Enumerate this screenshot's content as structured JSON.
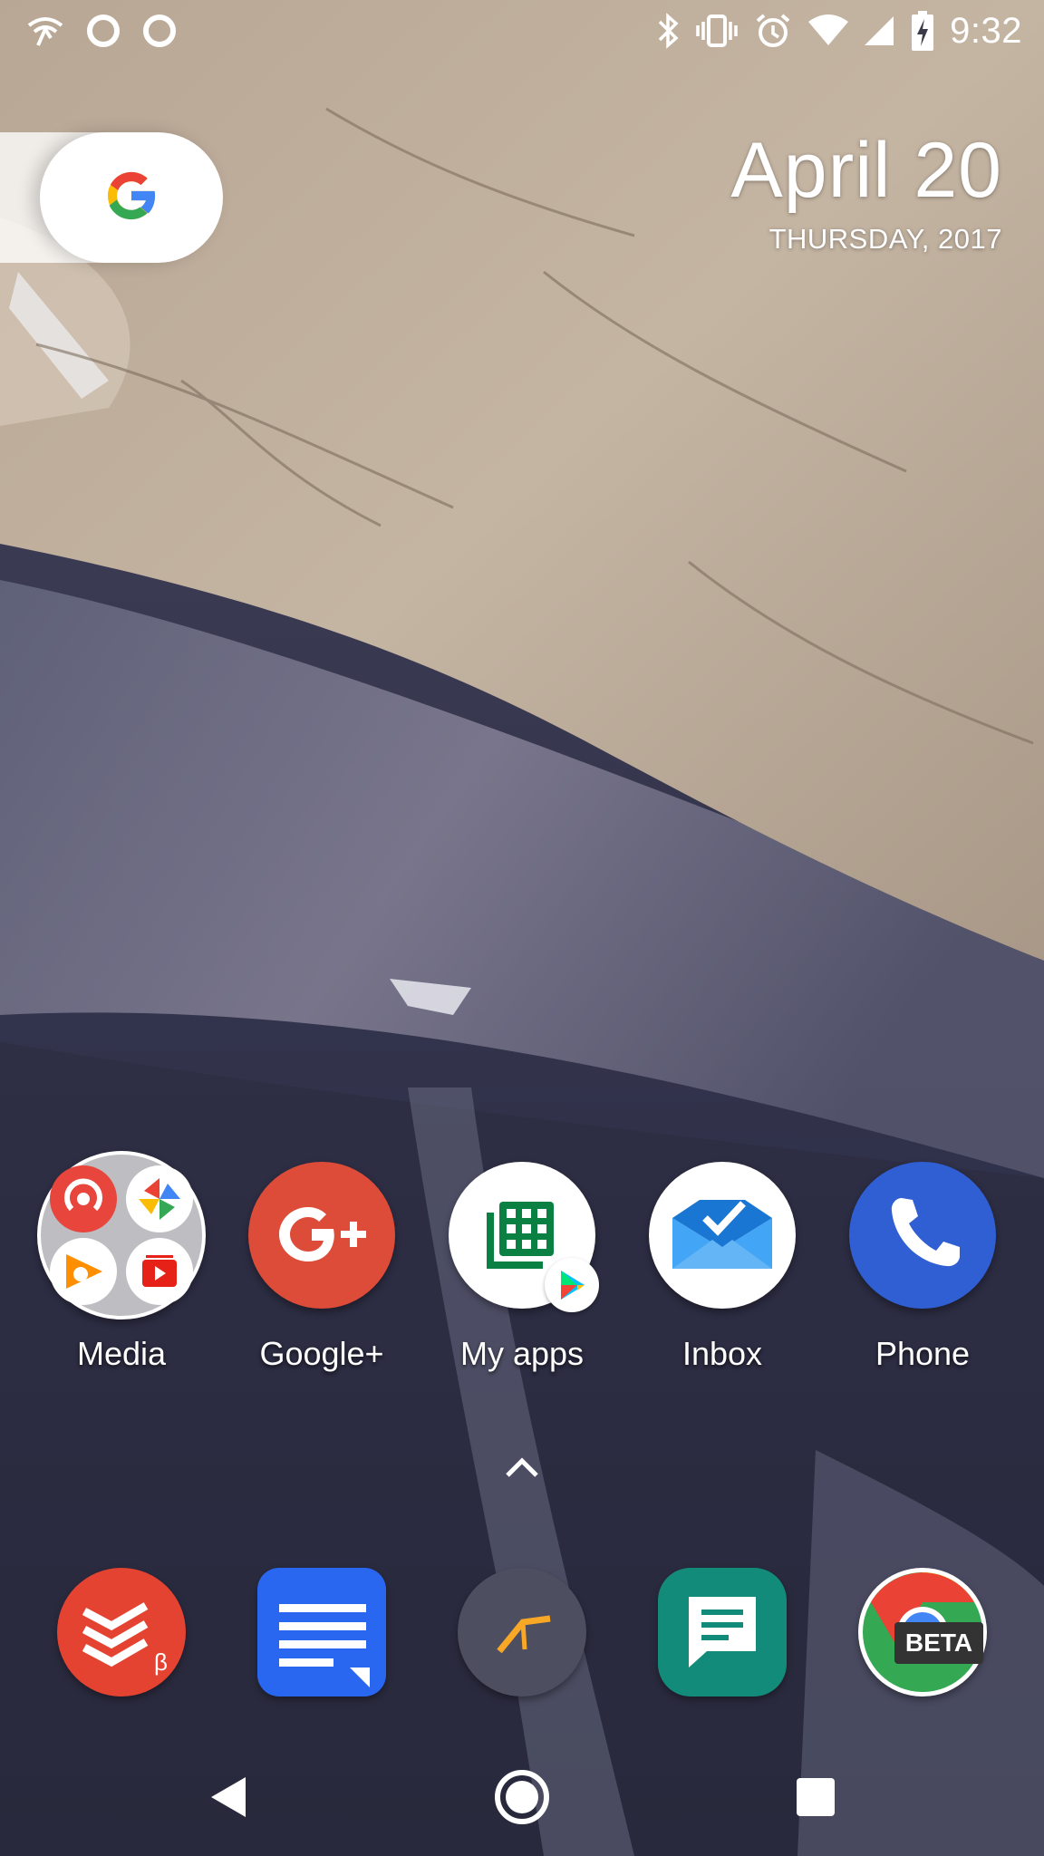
{
  "status_bar": {
    "time": "9:32",
    "left_icons": [
      "wifi-calling-icon",
      "circle-notification-icon",
      "circle-notification-icon"
    ],
    "right_icons": [
      "bluetooth-icon",
      "vibrate-icon",
      "alarm-icon",
      "wifi-icon",
      "cell-signal-icon",
      "battery-charging-icon"
    ]
  },
  "search_widget": {
    "icon": "google-g-icon"
  },
  "date_widget": {
    "date": "April 20",
    "day_year": "THURSDAY, 2017"
  },
  "home_apps": [
    {
      "label": "Media",
      "icon": "media-folder-icon"
    },
    {
      "label": "Google+",
      "icon": "google-plus-icon"
    },
    {
      "label": "My apps",
      "icon": "my-apps-icon"
    },
    {
      "label": "Inbox",
      "icon": "inbox-icon"
    },
    {
      "label": "Phone",
      "icon": "phone-icon"
    }
  ],
  "dock": {
    "apps": [
      {
        "icon": "todoist-beta-icon",
        "badge": "β"
      },
      {
        "icon": "google-docs-icon"
      },
      {
        "icon": "app-drawer-dark-icon"
      },
      {
        "icon": "messages-icon"
      },
      {
        "icon": "chrome-beta-icon",
        "badge": "BETA"
      }
    ]
  },
  "colors": {
    "google_blue": "#4285F4",
    "google_red": "#EA4335",
    "google_yellow": "#FBBC05",
    "google_green": "#34A853",
    "gplus_red": "#DD4B39",
    "phone_blue": "#2F5FD3",
    "messages_teal": "#138B7A",
    "todoist_red": "#E44332"
  },
  "nav_bar": {
    "buttons": [
      "back-icon",
      "home-icon",
      "recents-icon"
    ]
  }
}
